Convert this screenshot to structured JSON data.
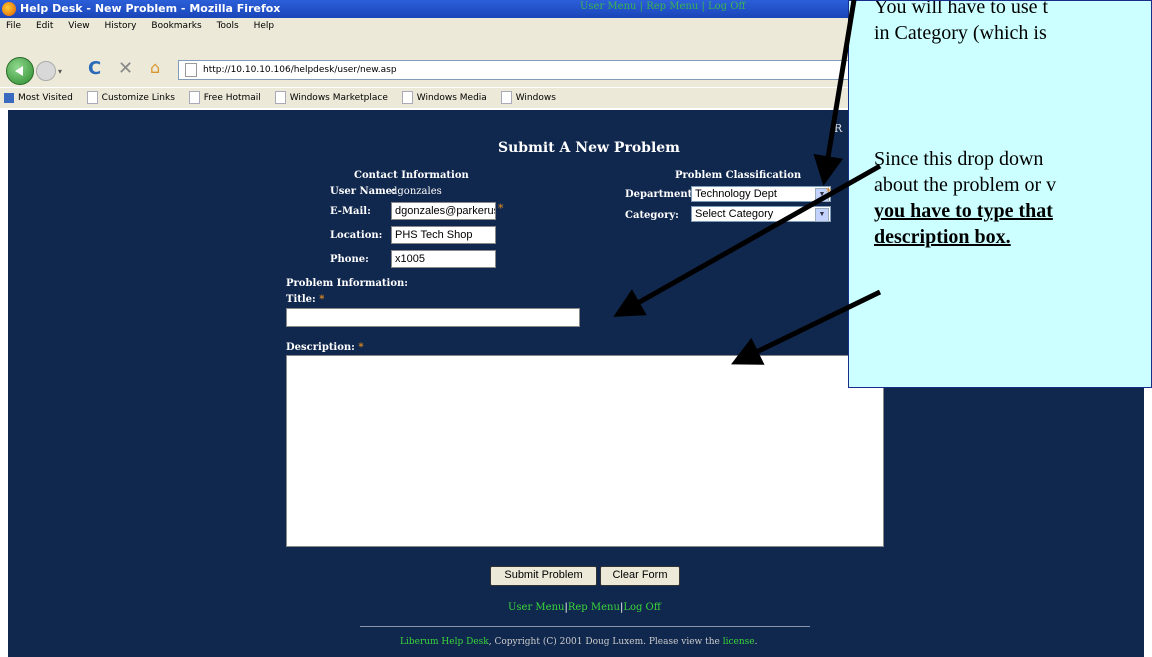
{
  "window": {
    "title": "Help Desk - New Problem - Mozilla Firefox",
    "overlay_links": "User Menu | Rep Menu | Log Off"
  },
  "menu": [
    "File",
    "Edit",
    "View",
    "History",
    "Bookmarks",
    "Tools",
    "Help"
  ],
  "nav": {
    "url": "http://10.10.10.106/helpdesk/user/new.asp"
  },
  "bookmarks": [
    "Most Visited",
    "Customize Links",
    "Free Hotmail",
    "Windows Marketplace",
    "Windows Media",
    "Windows"
  ],
  "form": {
    "heading": "Submit A New Problem",
    "contact_heading": "Contact Information",
    "classification_heading": "Problem Classification",
    "username_label": "User Name:",
    "username_value": "dgonzales",
    "email_label": "E-Mail:",
    "email_value": "dgonzales@parkerusd.",
    "location_label": "Location:",
    "location_value": "PHS Tech Shop",
    "phone_label": "Phone:",
    "phone_value": "x1005",
    "department_label": "Department:",
    "department_value": "Technology Dept",
    "category_label": "Category:",
    "category_value": "Select Category",
    "problem_info_heading": "Problem Information:",
    "title_label": "Title:",
    "description_label": "Description:",
    "required_mark": "*",
    "submit_label": "Submit Problem",
    "clear_label": "Clear Form",
    "right_fragment": "R"
  },
  "footer": {
    "user_menu": "User Menu",
    "rep_menu": "Rep Menu",
    "log_off": "Log Off",
    "sep": "|",
    "liberum": "Liberum Help Desk",
    "copyright": ", Copyright (C) 2001 Doug Luxem. Please view the ",
    "license": "license",
    "period": "."
  },
  "callout": {
    "line1": "You will have to use t",
    "line2": "in Category (which is",
    "line3": "Since this drop down",
    "line4": "about the problem or v",
    "line5": "you have to type that",
    "line6": "description box."
  },
  "colors": {
    "page_bg": "#11284e",
    "callout_bg": "#ccffff",
    "link_green": "#39d539",
    "required_orange": "#e08c20"
  }
}
